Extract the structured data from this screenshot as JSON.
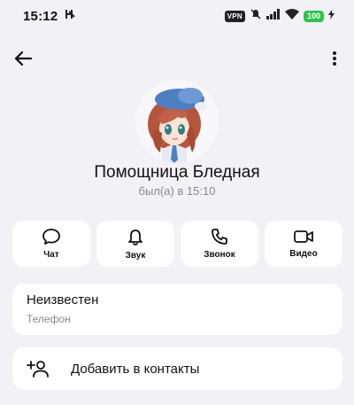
{
  "status_bar": {
    "time": "15:12",
    "vpn": "VPN",
    "battery": "100"
  },
  "profile": {
    "name": "Помощница Бледная",
    "last_seen": "был(а) в 15:10"
  },
  "actions": [
    {
      "label": "Чат",
      "icon": "chat-bubble-icon"
    },
    {
      "label": "Звук",
      "icon": "bell-icon"
    },
    {
      "label": "Звонок",
      "icon": "phone-icon"
    },
    {
      "label": "Видео",
      "icon": "video-camera-icon"
    }
  ],
  "phone": {
    "value": "Неизвестен",
    "label": "Телефон"
  },
  "add_contact": {
    "label": "Добавить в контакты"
  },
  "colors": {
    "background": "#f2f2f6",
    "card": "#ffffff",
    "battery": "#31c24d",
    "secondary_text": "#8a8a8e"
  }
}
